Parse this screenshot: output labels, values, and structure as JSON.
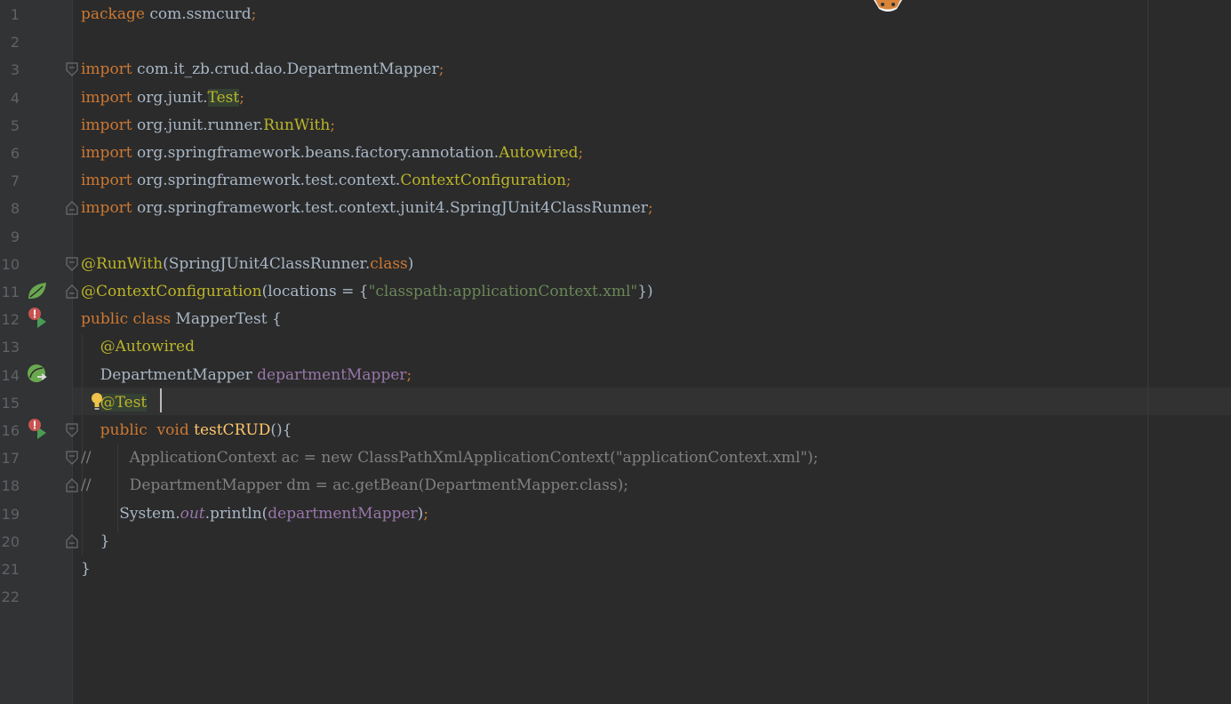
{
  "editor": {
    "language": "java",
    "current_line": 15,
    "lines": [
      {
        "n": "1",
        "parts": [
          {
            "t": "package ",
            "c": "kw"
          },
          {
            "t": "com.ssmcurd"
          },
          {
            "t": ";",
            "c": "kw"
          }
        ]
      },
      {
        "n": "2",
        "parts": []
      },
      {
        "n": "3",
        "parts": [
          {
            "t": "import ",
            "c": "kw"
          },
          {
            "t": "com.it_zb.crud.dao.DepartmentMapper"
          },
          {
            "t": ";",
            "c": "kw"
          }
        ]
      },
      {
        "n": "4",
        "parts": [
          {
            "t": "import ",
            "c": "kw"
          },
          {
            "t": "org.junit."
          },
          {
            "t": "Test",
            "c": "ann hl-test"
          },
          {
            "t": ";",
            "c": "kw"
          }
        ]
      },
      {
        "n": "5",
        "parts": [
          {
            "t": "import ",
            "c": "kw"
          },
          {
            "t": "org.junit.runner."
          },
          {
            "t": "RunWith",
            "c": "ann"
          },
          {
            "t": ";",
            "c": "kw"
          }
        ]
      },
      {
        "n": "6",
        "parts": [
          {
            "t": "import ",
            "c": "kw"
          },
          {
            "t": "org.springframework.beans.factory.annotation."
          },
          {
            "t": "Autowired",
            "c": "ann"
          },
          {
            "t": ";",
            "c": "kw"
          }
        ]
      },
      {
        "n": "7",
        "parts": [
          {
            "t": "import ",
            "c": "kw"
          },
          {
            "t": "org.springframework.test.context."
          },
          {
            "t": "ContextConfiguration",
            "c": "ann"
          },
          {
            "t": ";",
            "c": "kw"
          }
        ]
      },
      {
        "n": "8",
        "parts": [
          {
            "t": "import ",
            "c": "kw"
          },
          {
            "t": "org.springframework.test.context.junit4.SpringJUnit4ClassRunner"
          },
          {
            "t": ";",
            "c": "kw"
          }
        ]
      },
      {
        "n": "9",
        "parts": []
      },
      {
        "n": "10",
        "parts": [
          {
            "t": "@RunWith",
            "c": "ann"
          },
          {
            "t": "(SpringJUnit4ClassRunner."
          },
          {
            "t": "class",
            "c": "kw"
          },
          {
            "t": ")"
          }
        ]
      },
      {
        "n": "11",
        "parts": [
          {
            "t": "@ContextConfiguration",
            "c": "ann"
          },
          {
            "t": "(locations = {"
          },
          {
            "t": "\"classpath:applicationContext.xml\"",
            "c": "str"
          },
          {
            "t": "})"
          }
        ]
      },
      {
        "n": "12",
        "parts": [
          {
            "t": "public class ",
            "c": "kw"
          },
          {
            "t": "MapperTest {"
          }
        ]
      },
      {
        "n": "13",
        "parts": [
          {
            "t": "    "
          },
          {
            "t": "@Autowired",
            "c": "ann"
          }
        ]
      },
      {
        "n": "14",
        "parts": [
          {
            "t": "    DepartmentMapper "
          },
          {
            "t": "departmentMapper",
            "c": "fld"
          },
          {
            "t": ";",
            "c": "kw"
          }
        ]
      },
      {
        "n": "15",
        "parts": [
          {
            "t": "    "
          },
          {
            "t": "@Test",
            "c": "ann hl-test"
          }
        ]
      },
      {
        "n": "16",
        "parts": [
          {
            "t": "    "
          },
          {
            "t": "public  void ",
            "c": "kw"
          },
          {
            "t": "testCRUD",
            "c": "mth"
          },
          {
            "t": "(){"
          }
        ]
      },
      {
        "n": "17",
        "parts": [
          {
            "t": "//        ApplicationContext ac = new ClassPathXmlApplicationContext(\"applicationContext.xml\");",
            "c": "cmt"
          }
        ]
      },
      {
        "n": "18",
        "parts": [
          {
            "t": "//        DepartmentMapper dm = ac.getBean(DepartmentMapper.class);",
            "c": "cmt"
          }
        ]
      },
      {
        "n": "19",
        "parts": [
          {
            "t": "        System."
          },
          {
            "t": "out",
            "c": "fld-i"
          },
          {
            "t": ".println("
          },
          {
            "t": "departmentMapper",
            "c": "fld"
          },
          {
            "t": ")"
          },
          {
            "t": ";",
            "c": "kw"
          }
        ]
      },
      {
        "n": "20",
        "parts": [
          {
            "t": "    }"
          }
        ]
      },
      {
        "n": "21",
        "parts": [
          {
            "t": "}"
          }
        ]
      },
      {
        "n": "22",
        "parts": []
      }
    ]
  },
  "gutter_icons": [
    {
      "line": 11,
      "icon": "spring-bean-icon"
    },
    {
      "line": 12,
      "icon": "run-test-error-icon"
    },
    {
      "line": 14,
      "icon": "autowired-navigate-icon"
    },
    {
      "line": 15,
      "icon": "intention-bulb-icon"
    },
    {
      "line": 16,
      "icon": "run-test-error-icon"
    }
  ],
  "fold_markers": [
    {
      "line": 3,
      "kind": "start"
    },
    {
      "line": 8,
      "kind": "end"
    },
    {
      "line": 10,
      "kind": "start"
    },
    {
      "line": 11,
      "kind": "end"
    },
    {
      "line": 16,
      "kind": "start"
    },
    {
      "line": 17,
      "kind": "start"
    },
    {
      "line": 18,
      "kind": "end"
    },
    {
      "line": 20,
      "kind": "end"
    }
  ],
  "colors": {
    "background": "#2b2b2b",
    "gutter": "#313335",
    "keyword": "#cc7832",
    "annotation": "#bbb529",
    "string": "#6a8759",
    "field": "#9876aa",
    "method": "#ffc66d",
    "comment": "#808080",
    "default": "#a9b7c6"
  }
}
